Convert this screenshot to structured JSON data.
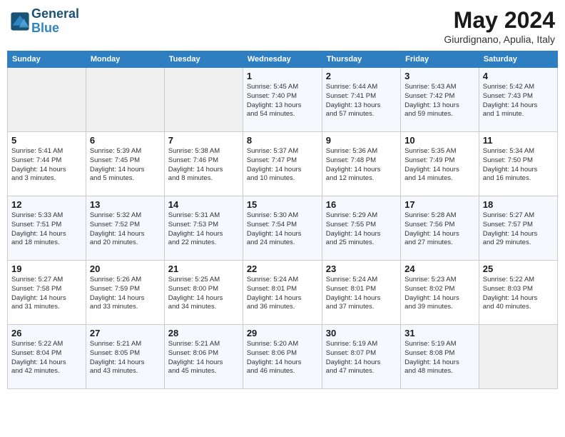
{
  "header": {
    "logo_line1": "General",
    "logo_line2": "Blue",
    "month": "May 2024",
    "location": "Giurdignano, Apulia, Italy"
  },
  "days_of_week": [
    "Sunday",
    "Monday",
    "Tuesday",
    "Wednesday",
    "Thursday",
    "Friday",
    "Saturday"
  ],
  "weeks": [
    [
      {
        "day": "",
        "info": ""
      },
      {
        "day": "",
        "info": ""
      },
      {
        "day": "",
        "info": ""
      },
      {
        "day": "1",
        "info": "Sunrise: 5:45 AM\nSunset: 7:40 PM\nDaylight: 13 hours\nand 54 minutes."
      },
      {
        "day": "2",
        "info": "Sunrise: 5:44 AM\nSunset: 7:41 PM\nDaylight: 13 hours\nand 57 minutes."
      },
      {
        "day": "3",
        "info": "Sunrise: 5:43 AM\nSunset: 7:42 PM\nDaylight: 13 hours\nand 59 minutes."
      },
      {
        "day": "4",
        "info": "Sunrise: 5:42 AM\nSunset: 7:43 PM\nDaylight: 14 hours\nand 1 minute."
      }
    ],
    [
      {
        "day": "5",
        "info": "Sunrise: 5:41 AM\nSunset: 7:44 PM\nDaylight: 14 hours\nand 3 minutes."
      },
      {
        "day": "6",
        "info": "Sunrise: 5:39 AM\nSunset: 7:45 PM\nDaylight: 14 hours\nand 5 minutes."
      },
      {
        "day": "7",
        "info": "Sunrise: 5:38 AM\nSunset: 7:46 PM\nDaylight: 14 hours\nand 8 minutes."
      },
      {
        "day": "8",
        "info": "Sunrise: 5:37 AM\nSunset: 7:47 PM\nDaylight: 14 hours\nand 10 minutes."
      },
      {
        "day": "9",
        "info": "Sunrise: 5:36 AM\nSunset: 7:48 PM\nDaylight: 14 hours\nand 12 minutes."
      },
      {
        "day": "10",
        "info": "Sunrise: 5:35 AM\nSunset: 7:49 PM\nDaylight: 14 hours\nand 14 minutes."
      },
      {
        "day": "11",
        "info": "Sunrise: 5:34 AM\nSunset: 7:50 PM\nDaylight: 14 hours\nand 16 minutes."
      }
    ],
    [
      {
        "day": "12",
        "info": "Sunrise: 5:33 AM\nSunset: 7:51 PM\nDaylight: 14 hours\nand 18 minutes."
      },
      {
        "day": "13",
        "info": "Sunrise: 5:32 AM\nSunset: 7:52 PM\nDaylight: 14 hours\nand 20 minutes."
      },
      {
        "day": "14",
        "info": "Sunrise: 5:31 AM\nSunset: 7:53 PM\nDaylight: 14 hours\nand 22 minutes."
      },
      {
        "day": "15",
        "info": "Sunrise: 5:30 AM\nSunset: 7:54 PM\nDaylight: 14 hours\nand 24 minutes."
      },
      {
        "day": "16",
        "info": "Sunrise: 5:29 AM\nSunset: 7:55 PM\nDaylight: 14 hours\nand 25 minutes."
      },
      {
        "day": "17",
        "info": "Sunrise: 5:28 AM\nSunset: 7:56 PM\nDaylight: 14 hours\nand 27 minutes."
      },
      {
        "day": "18",
        "info": "Sunrise: 5:27 AM\nSunset: 7:57 PM\nDaylight: 14 hours\nand 29 minutes."
      }
    ],
    [
      {
        "day": "19",
        "info": "Sunrise: 5:27 AM\nSunset: 7:58 PM\nDaylight: 14 hours\nand 31 minutes."
      },
      {
        "day": "20",
        "info": "Sunrise: 5:26 AM\nSunset: 7:59 PM\nDaylight: 14 hours\nand 33 minutes."
      },
      {
        "day": "21",
        "info": "Sunrise: 5:25 AM\nSunset: 8:00 PM\nDaylight: 14 hours\nand 34 minutes."
      },
      {
        "day": "22",
        "info": "Sunrise: 5:24 AM\nSunset: 8:01 PM\nDaylight: 14 hours\nand 36 minutes."
      },
      {
        "day": "23",
        "info": "Sunrise: 5:24 AM\nSunset: 8:01 PM\nDaylight: 14 hours\nand 37 minutes."
      },
      {
        "day": "24",
        "info": "Sunrise: 5:23 AM\nSunset: 8:02 PM\nDaylight: 14 hours\nand 39 minutes."
      },
      {
        "day": "25",
        "info": "Sunrise: 5:22 AM\nSunset: 8:03 PM\nDaylight: 14 hours\nand 40 minutes."
      }
    ],
    [
      {
        "day": "26",
        "info": "Sunrise: 5:22 AM\nSunset: 8:04 PM\nDaylight: 14 hours\nand 42 minutes."
      },
      {
        "day": "27",
        "info": "Sunrise: 5:21 AM\nSunset: 8:05 PM\nDaylight: 14 hours\nand 43 minutes."
      },
      {
        "day": "28",
        "info": "Sunrise: 5:21 AM\nSunset: 8:06 PM\nDaylight: 14 hours\nand 45 minutes."
      },
      {
        "day": "29",
        "info": "Sunrise: 5:20 AM\nSunset: 8:06 PM\nDaylight: 14 hours\nand 46 minutes."
      },
      {
        "day": "30",
        "info": "Sunrise: 5:19 AM\nSunset: 8:07 PM\nDaylight: 14 hours\nand 47 minutes."
      },
      {
        "day": "31",
        "info": "Sunrise: 5:19 AM\nSunset: 8:08 PM\nDaylight: 14 hours\nand 48 minutes."
      },
      {
        "day": "",
        "info": ""
      }
    ]
  ]
}
